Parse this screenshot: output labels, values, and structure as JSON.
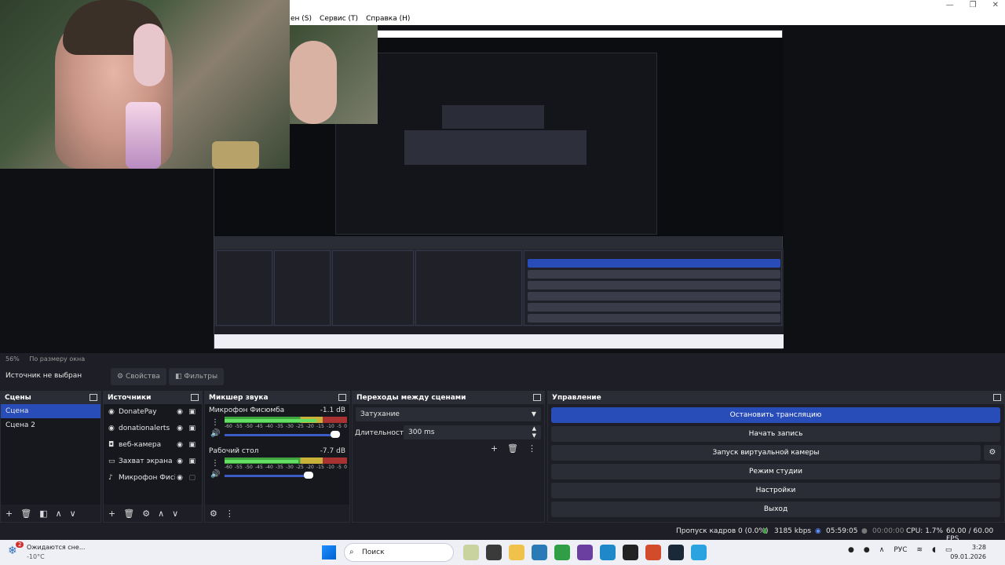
{
  "menu": {
    "items": [
      "ен (S)",
      "Сервис (T)",
      "Справка (H)"
    ]
  },
  "preview": {
    "zoom": "56%",
    "zoom_mode": "По размеру окна"
  },
  "source_bar": {
    "label": "Источник не выбран",
    "properties": "Свойства",
    "filters": "Фильтры"
  },
  "scenes": {
    "title": "Сцены",
    "items": [
      "Сцена",
      "Сцена 2"
    ]
  },
  "sources": {
    "title": "Источники",
    "items": [
      {
        "name": "DonatePay",
        "icon": "browser-icon"
      },
      {
        "name": "donationalerts",
        "icon": "browser-icon"
      },
      {
        "name": "веб-камера",
        "icon": "camera-icon"
      },
      {
        "name": "Захват экрана",
        "icon": "monitor-icon"
      },
      {
        "name": "Микрофон Фисі",
        "icon": "mic-icon"
      }
    ]
  },
  "mixer": {
    "title": "Микшер звука",
    "channels": [
      {
        "name": "Микрофон Фисюмба",
        "db": "-1.1 dB",
        "level": 0.75
      },
      {
        "name": "Рабочий стол",
        "db": "-7.7 dB",
        "level": 0.6
      }
    ],
    "ticks": [
      "-60",
      "-55",
      "-50",
      "-45",
      "-40",
      "-35",
      "-30",
      "-25",
      "-20",
      "-15",
      "-10",
      "-5",
      "0"
    ]
  },
  "transitions": {
    "title": "Переходы между сценами",
    "selected": "Затухание",
    "duration_label": "Длительность",
    "duration_value": "300 ms"
  },
  "controls": {
    "title": "Управление",
    "buttons": [
      "Остановить трансляцию",
      "Начать запись",
      "Запуск виртуальной камеры",
      "Режим студии",
      "Настройки",
      "Выход"
    ]
  },
  "status": {
    "dropped": "Пропуск кадров 0 (0.0%)",
    "bitrate": "3185 kbps",
    "stream_time": "05:59:05",
    "rec_time": "00:00:00",
    "cpu": "CPU: 1.7%",
    "fps": "60.00 / 60.00 FPS"
  },
  "taskbar": {
    "weather_line1": "Ожидаются сне...",
    "weather_line2": "-10°C",
    "weather_badge": "2",
    "search": "Поиск",
    "lang": "РУС",
    "time": "3:28",
    "date": "09.01.2026"
  },
  "colors": {
    "accent": "#284cb8",
    "panel": "#1e1f26",
    "panel_header": "#2a2c36"
  }
}
